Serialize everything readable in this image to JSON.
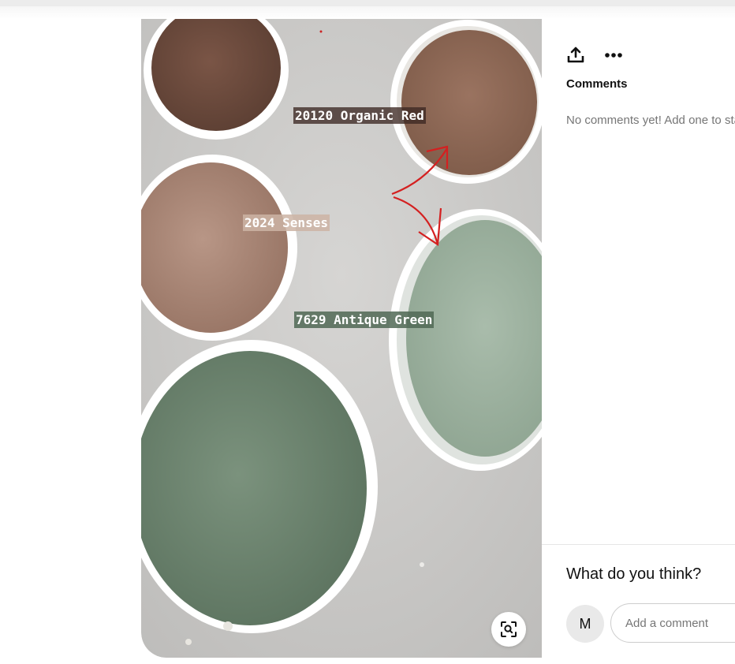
{
  "pin": {
    "image_name": "paint-color-swatches-photo",
    "labels": {
      "organic_red": "20120 Organic Red",
      "senses": "2024 Senses",
      "antique_green": "7629 Antique Green"
    },
    "colors": {
      "organic_red": "#8a6450",
      "senses": "#a88576",
      "antique_green": "#6f8771",
      "sage_lid": "#9bb09e",
      "dark_brown": "#6a4a3e",
      "background": "#c9c8c6"
    }
  },
  "actions": {
    "share_icon": "share-upload-icon",
    "more_icon": "more-horizontal-icon",
    "visual_search_icon": "visual-search-icon"
  },
  "comments": {
    "heading": "Comments",
    "empty_text": "No comments yet! Add one to start the conversation."
  },
  "composer": {
    "title": "What do you think?",
    "avatar_initial": "M",
    "placeholder": "Add a comment"
  }
}
